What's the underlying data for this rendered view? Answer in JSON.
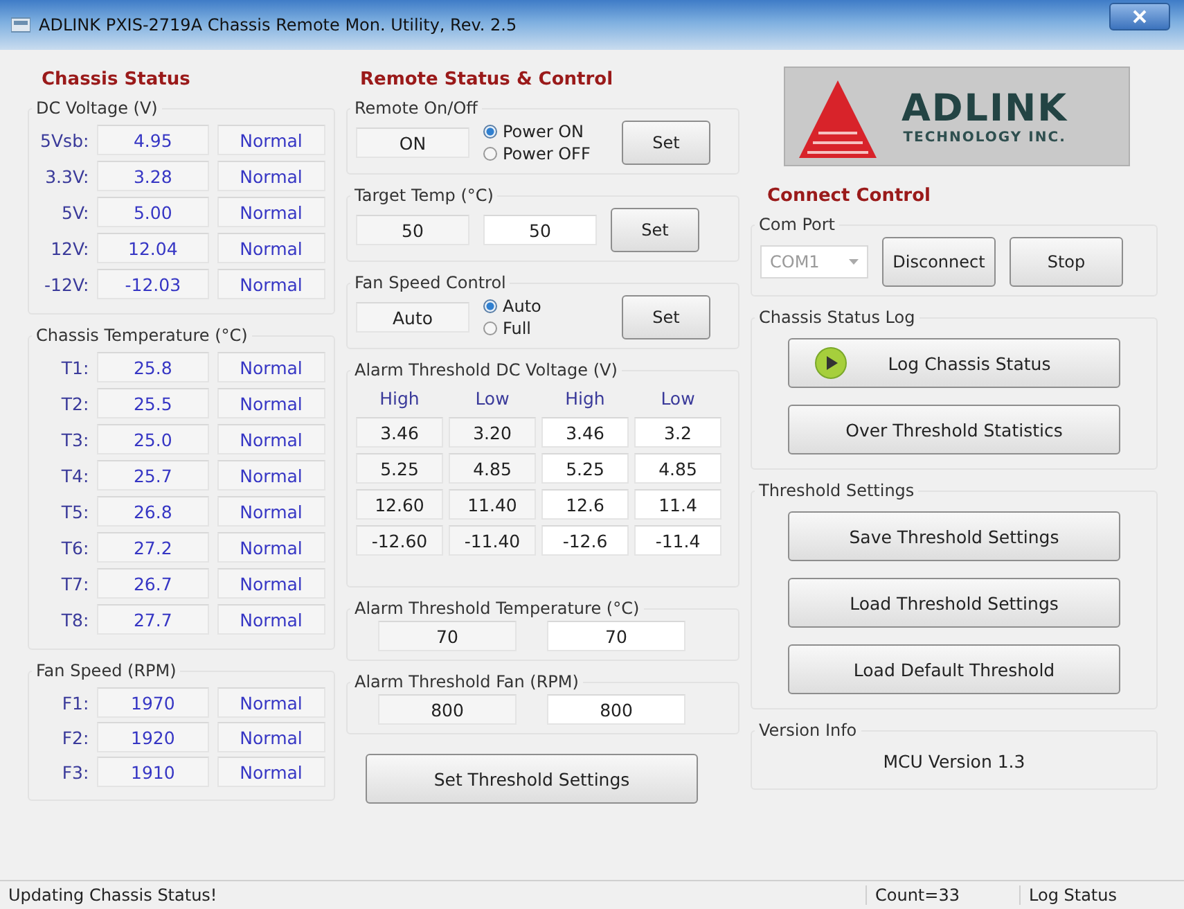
{
  "window": {
    "title": "ADLINK PXIS-2719A Chassis Remote Mon. Utility, Rev. 2.5"
  },
  "chassis_status": {
    "heading": "Chassis Status",
    "groups": [
      {
        "title": "DC Voltage (V)",
        "rows": [
          {
            "label": "5Vsb:",
            "value": "4.95",
            "status": "Normal"
          },
          {
            "label": "3.3V:",
            "value": "3.28",
            "status": "Normal"
          },
          {
            "label": "5V:",
            "value": "5.00",
            "status": "Normal"
          },
          {
            "label": "12V:",
            "value": "12.04",
            "status": "Normal"
          },
          {
            "label": "-12V:",
            "value": "-12.03",
            "status": "Normal"
          }
        ]
      },
      {
        "title": "Chassis Temperature (°C)",
        "rows": [
          {
            "label": "T1:",
            "value": "25.8",
            "status": "Normal"
          },
          {
            "label": "T2:",
            "value": "25.5",
            "status": "Normal"
          },
          {
            "label": "T3:",
            "value": "25.0",
            "status": "Normal"
          },
          {
            "label": "T4:",
            "value": "25.7",
            "status": "Normal"
          },
          {
            "label": "T5:",
            "value": "26.8",
            "status": "Normal"
          },
          {
            "label": "T6:",
            "value": "27.2",
            "status": "Normal"
          },
          {
            "label": "T7:",
            "value": "26.7",
            "status": "Normal"
          },
          {
            "label": "T8:",
            "value": "27.7",
            "status": "Normal"
          }
        ]
      },
      {
        "title": "Fan Speed (RPM)",
        "rows": [
          {
            "label": "F1:",
            "value": "1970",
            "status": "Normal"
          },
          {
            "label": "F2:",
            "value": "1920",
            "status": "Normal"
          },
          {
            "label": "F3:",
            "value": "1910",
            "status": "Normal"
          }
        ]
      }
    ]
  },
  "remote": {
    "heading": "Remote Status & Control",
    "on_off": {
      "title": "Remote On/Off",
      "value": "ON",
      "options": [
        {
          "label": "Power ON",
          "selected": true
        },
        {
          "label": "Power OFF",
          "selected": false
        }
      ],
      "button": "Set"
    },
    "target_temp": {
      "title": "Target Temp (°C)",
      "current": "50",
      "input": "50",
      "button": "Set"
    },
    "fan_control": {
      "title": "Fan Speed Control",
      "value": "Auto",
      "options": [
        {
          "label": "Auto",
          "selected": true
        },
        {
          "label": "Full",
          "selected": false
        }
      ],
      "button": "Set"
    },
    "alarm_dc": {
      "title": "Alarm Threshold DC Voltage (V)",
      "columns": [
        "High",
        "Low",
        "High",
        "Low"
      ],
      "rows": [
        [
          "3.46",
          "3.20",
          "3.46",
          "3.2"
        ],
        [
          "5.25",
          "4.85",
          "5.25",
          "4.85"
        ],
        [
          "12.60",
          "11.40",
          "12.6",
          "11.4"
        ],
        [
          "-12.60",
          "-11.40",
          "-12.6",
          "-11.4"
        ]
      ]
    },
    "alarm_temp": {
      "title": "Alarm Threshold Temperature (°C)",
      "current": "70",
      "input": "70"
    },
    "alarm_fan": {
      "title": "Alarm Threshold Fan (RPM)",
      "current": "800",
      "input": "800"
    },
    "set_button": "Set Threshold Settings"
  },
  "logo": {
    "name": "ADLINK",
    "tagline": "TECHNOLOGY INC."
  },
  "connect": {
    "heading": "Connect Control",
    "com_port": {
      "title": "Com Port",
      "value": "COM1",
      "disabled": true,
      "buttons": [
        "Disconnect",
        "Stop"
      ]
    },
    "log": {
      "title": "Chassis Status Log",
      "buttons": [
        {
          "label": "Log Chassis Status",
          "kind": "play"
        },
        {
          "label": "Over Threshold Statistics",
          "kind": "plain"
        }
      ]
    },
    "threshold": {
      "title": "Threshold Settings",
      "buttons": [
        "Save Threshold Settings",
        "Load Threshold Settings",
        "Load Default Threshold"
      ]
    },
    "version": {
      "title": "Version Info",
      "text": "MCU Version 1.3"
    }
  },
  "status_bar": [
    "Updating Chassis Status!",
    "Count=33",
    "Log Status"
  ]
}
